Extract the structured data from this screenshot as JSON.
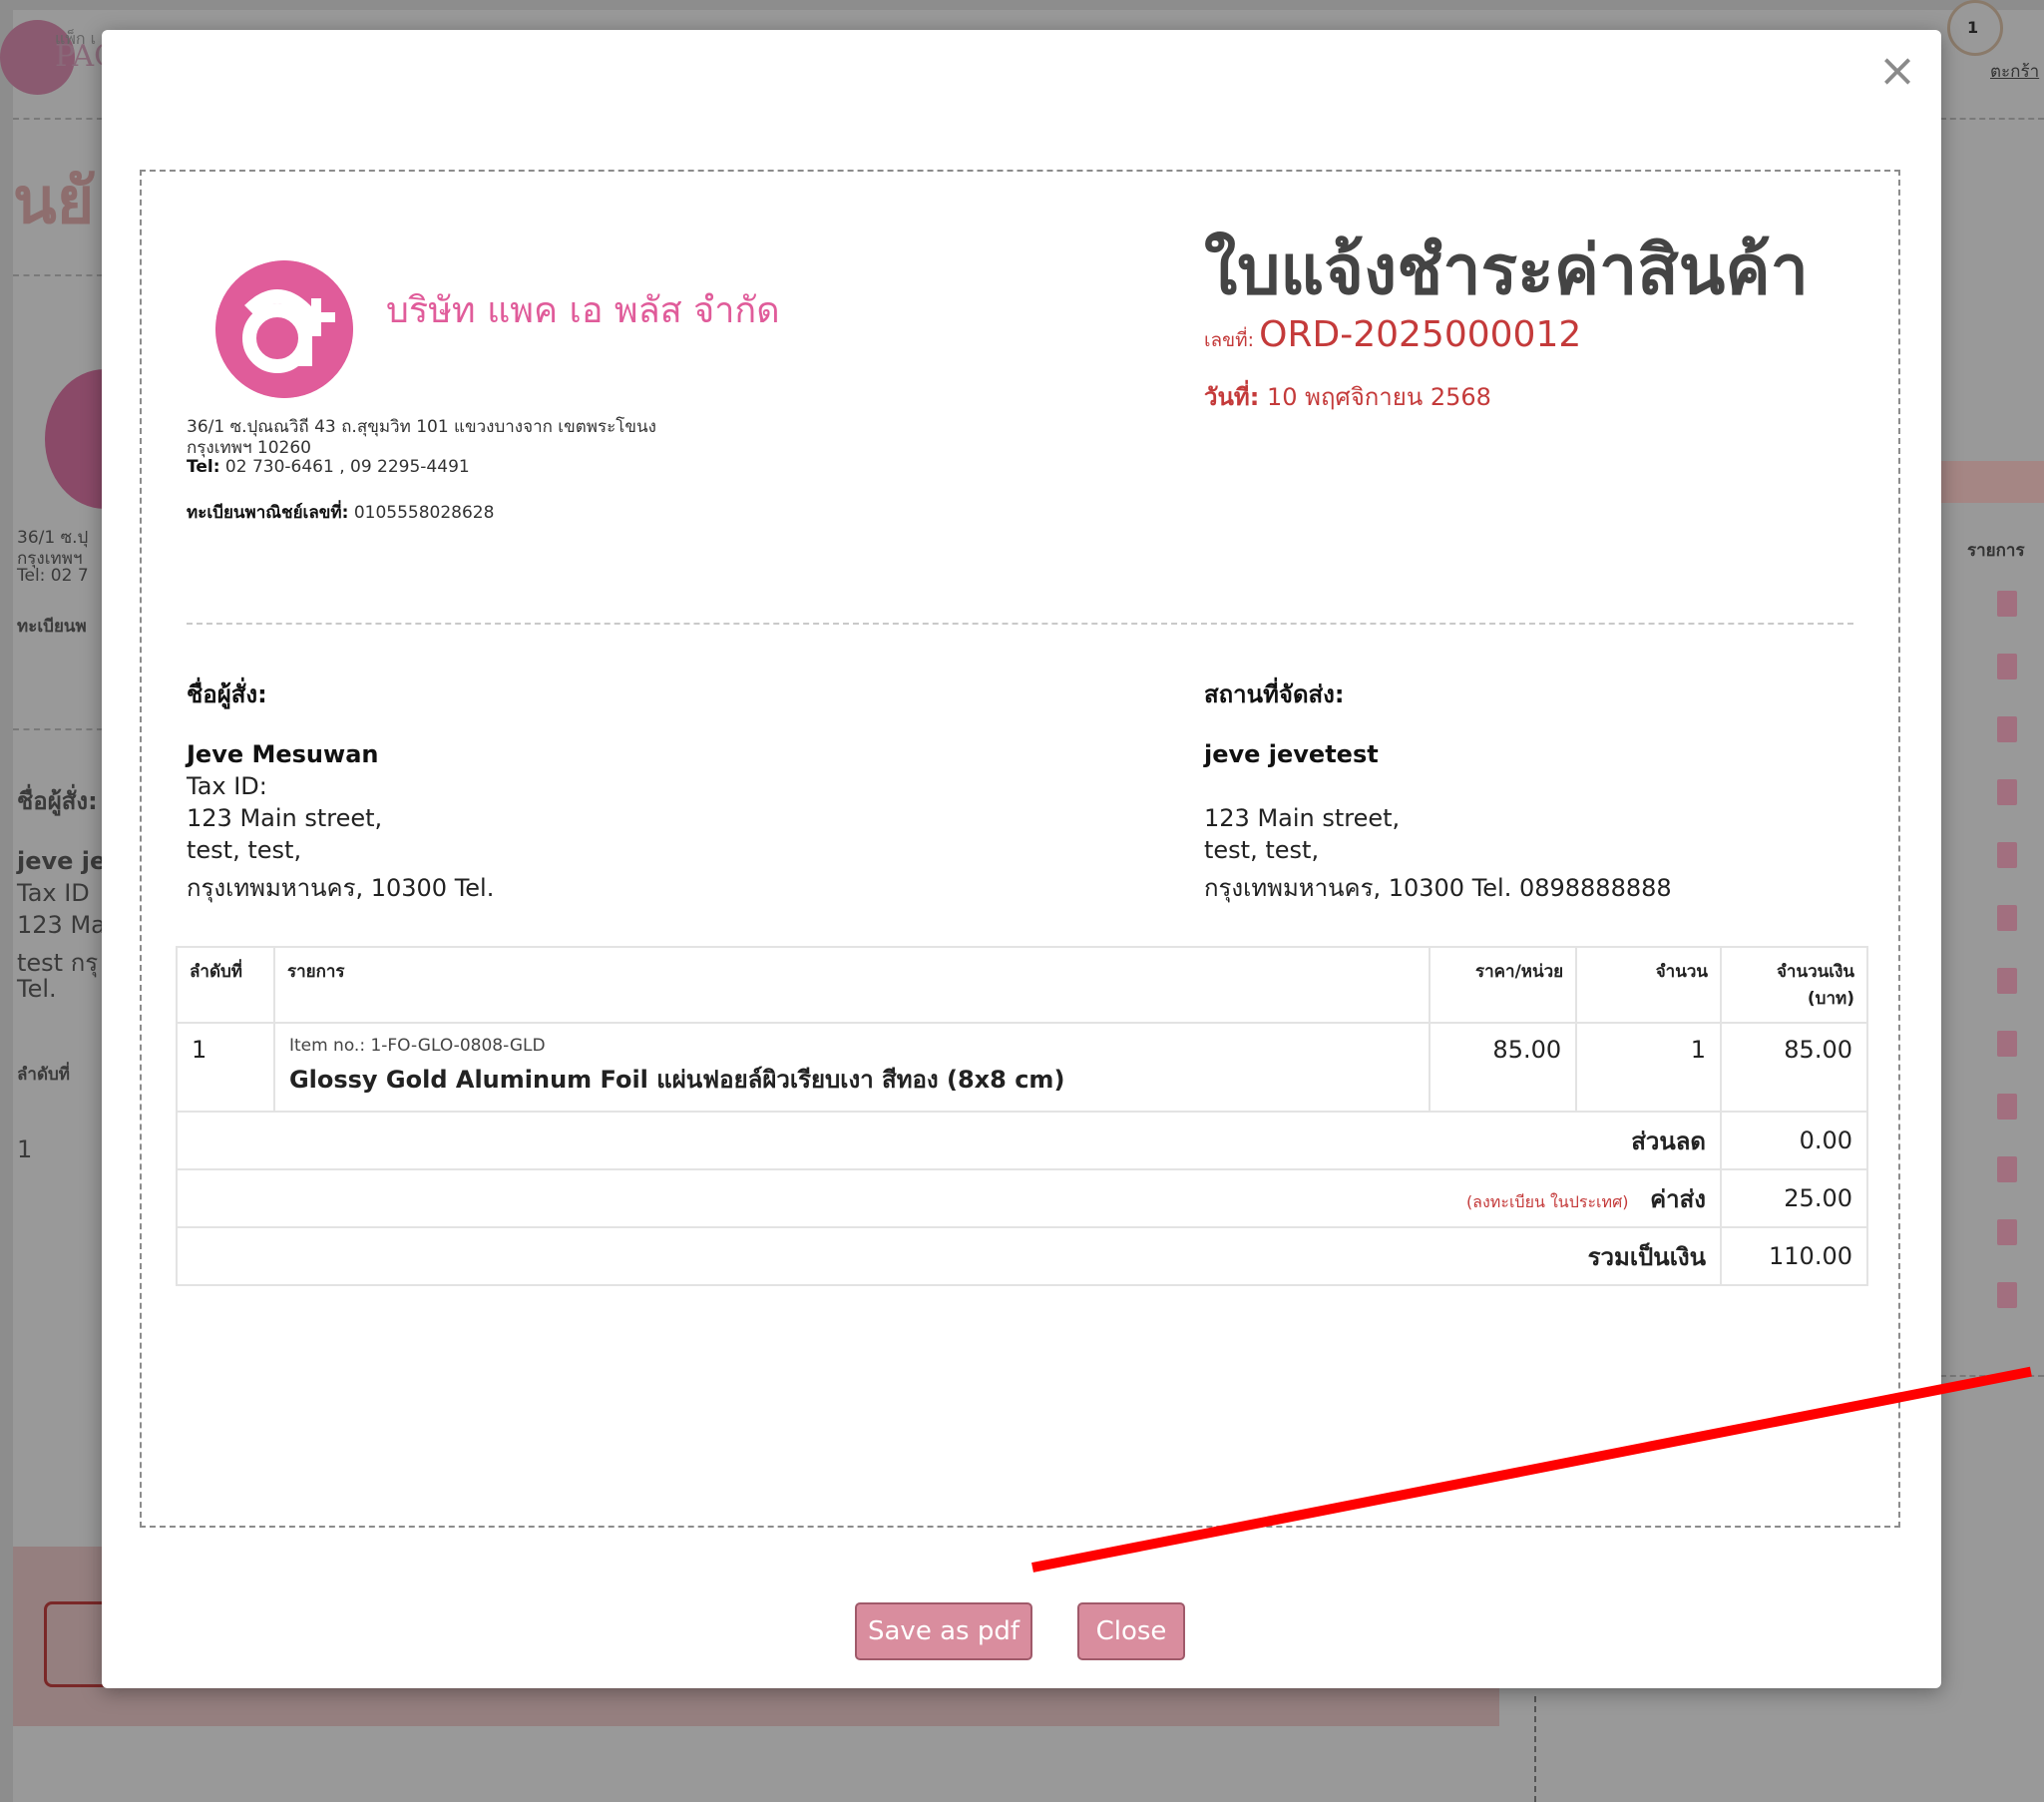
{
  "background": {
    "brand_small": "แพ็ก เ",
    "brand_big": "PAC",
    "heading": "นยั",
    "addr_line1": "36/1 ซ.ปุ",
    "addr_line2": "กรุงเทพฯ",
    "tel_line": "Tel: 02 7",
    "reg_line": "ทะเบียนพ",
    "buyer_label": "ชื่อผู้สั่ง:",
    "buyer_name": "jeve je",
    "buyer_tax": "Tax ID",
    "buyer_street": "123 Ma",
    "buyer_city": "test กรุ",
    "buyer_tel": "Tel.",
    "col_no": "ลำดับที่",
    "row_no": "1",
    "right_col_header": "รายการ",
    "cart_count": "1",
    "cart_label": "ตะกร้า"
  },
  "modal": {
    "close_symbol": "×",
    "company": {
      "name": "บริษัท แพค เอ พลัส จำกัด",
      "address_line1": "36/1 ซ.ปุณณวิถี 43 ถ.สุขุมวิท 101 แขวงบางจาก เขตพระโขนง",
      "address_line2": "กรุงเทพฯ 10260",
      "tel_label": "Tel:",
      "tel_value": "02 730-6461 , 09 2295-4491",
      "reg_label": "ทะเบียนพาณิชย์เลขที่:",
      "reg_value": "0105558028628"
    },
    "document": {
      "title": "ใบแจ้งชำระค่าสินค้า",
      "number_label": "เลขที่:",
      "number_value": "ORD-2025000012",
      "date_label": "วันที่:",
      "date_value": "10 พฤศจิกายน 2568"
    },
    "buyer": {
      "heading": "ชื่อผู้สั่ง:",
      "name": "Jeve Mesuwan",
      "tax": "Tax ID:",
      "street": "123 Main street,",
      "city": "test, test,",
      "province": "กรุงเทพมหานคร, 10300 Tel."
    },
    "shipping": {
      "heading": "สถานที่จัดส่ง:",
      "name": "jeve jevetest",
      "street": "123 Main street,",
      "city": "test, test,",
      "province": "กรุงเทพมหานคร, 10300 Tel. 0898888888"
    },
    "table": {
      "headers": {
        "no": "ลำดับที่",
        "item": "รายการ",
        "unit_price": "ราคา/หน่วย",
        "qty": "จำนวน",
        "amount_line1": "จำนวนเงิน",
        "amount_line2": "(บาท)"
      },
      "rows": [
        {
          "no": "1",
          "item_no": "Item no.: 1-FO-GLO-0808-GLD",
          "item_name": "Glossy Gold Aluminum Foil แผ่นฟอยล์ผิวเรียบเงา สีทอง (8x8 cm)",
          "unit_price": "85.00",
          "qty": "1",
          "amount": "85.00"
        }
      ],
      "discount_label": "ส่วนลด",
      "discount_value": "0.00",
      "shipping_note": "(ลงทะเบียน ในประเทศ)",
      "shipping_label": "ค่าส่ง",
      "shipping_value": "25.00",
      "total_label": "รวมเป็นเงิน",
      "total_value": "110.00"
    },
    "buttons": {
      "save_pdf": "Save as pdf",
      "close": "Close"
    }
  },
  "colors": {
    "brand_pink": "#e05c9a",
    "accent_red": "#c43a3a",
    "button_pink": "#d98d9e",
    "annotation_arrow": "#ff0000"
  }
}
